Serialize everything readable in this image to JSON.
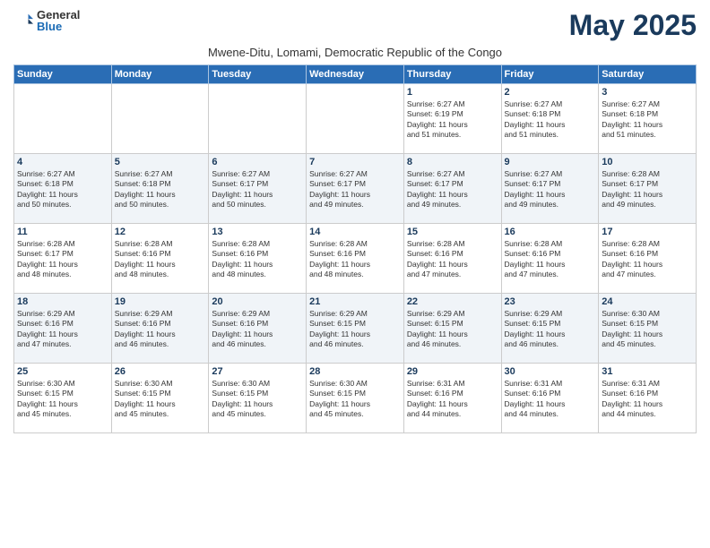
{
  "logo": {
    "general": "General",
    "blue": "Blue"
  },
  "title": "May 2025",
  "subtitle": "Mwene-Ditu, Lomami, Democratic Republic of the Congo",
  "days_header": [
    "Sunday",
    "Monday",
    "Tuesday",
    "Wednesday",
    "Thursday",
    "Friday",
    "Saturday"
  ],
  "weeks": [
    [
      {
        "day": "",
        "info": ""
      },
      {
        "day": "",
        "info": ""
      },
      {
        "day": "",
        "info": ""
      },
      {
        "day": "",
        "info": ""
      },
      {
        "day": "1",
        "info": "Sunrise: 6:27 AM\nSunset: 6:19 PM\nDaylight: 11 hours\nand 51 minutes."
      },
      {
        "day": "2",
        "info": "Sunrise: 6:27 AM\nSunset: 6:18 PM\nDaylight: 11 hours\nand 51 minutes."
      },
      {
        "day": "3",
        "info": "Sunrise: 6:27 AM\nSunset: 6:18 PM\nDaylight: 11 hours\nand 51 minutes."
      }
    ],
    [
      {
        "day": "4",
        "info": "Sunrise: 6:27 AM\nSunset: 6:18 PM\nDaylight: 11 hours\nand 50 minutes."
      },
      {
        "day": "5",
        "info": "Sunrise: 6:27 AM\nSunset: 6:18 PM\nDaylight: 11 hours\nand 50 minutes."
      },
      {
        "day": "6",
        "info": "Sunrise: 6:27 AM\nSunset: 6:17 PM\nDaylight: 11 hours\nand 50 minutes."
      },
      {
        "day": "7",
        "info": "Sunrise: 6:27 AM\nSunset: 6:17 PM\nDaylight: 11 hours\nand 49 minutes."
      },
      {
        "day": "8",
        "info": "Sunrise: 6:27 AM\nSunset: 6:17 PM\nDaylight: 11 hours\nand 49 minutes."
      },
      {
        "day": "9",
        "info": "Sunrise: 6:27 AM\nSunset: 6:17 PM\nDaylight: 11 hours\nand 49 minutes."
      },
      {
        "day": "10",
        "info": "Sunrise: 6:28 AM\nSunset: 6:17 PM\nDaylight: 11 hours\nand 49 minutes."
      }
    ],
    [
      {
        "day": "11",
        "info": "Sunrise: 6:28 AM\nSunset: 6:17 PM\nDaylight: 11 hours\nand 48 minutes."
      },
      {
        "day": "12",
        "info": "Sunrise: 6:28 AM\nSunset: 6:16 PM\nDaylight: 11 hours\nand 48 minutes."
      },
      {
        "day": "13",
        "info": "Sunrise: 6:28 AM\nSunset: 6:16 PM\nDaylight: 11 hours\nand 48 minutes."
      },
      {
        "day": "14",
        "info": "Sunrise: 6:28 AM\nSunset: 6:16 PM\nDaylight: 11 hours\nand 48 minutes."
      },
      {
        "day": "15",
        "info": "Sunrise: 6:28 AM\nSunset: 6:16 PM\nDaylight: 11 hours\nand 47 minutes."
      },
      {
        "day": "16",
        "info": "Sunrise: 6:28 AM\nSunset: 6:16 PM\nDaylight: 11 hours\nand 47 minutes."
      },
      {
        "day": "17",
        "info": "Sunrise: 6:28 AM\nSunset: 6:16 PM\nDaylight: 11 hours\nand 47 minutes."
      }
    ],
    [
      {
        "day": "18",
        "info": "Sunrise: 6:29 AM\nSunset: 6:16 PM\nDaylight: 11 hours\nand 47 minutes."
      },
      {
        "day": "19",
        "info": "Sunrise: 6:29 AM\nSunset: 6:16 PM\nDaylight: 11 hours\nand 46 minutes."
      },
      {
        "day": "20",
        "info": "Sunrise: 6:29 AM\nSunset: 6:16 PM\nDaylight: 11 hours\nand 46 minutes."
      },
      {
        "day": "21",
        "info": "Sunrise: 6:29 AM\nSunset: 6:15 PM\nDaylight: 11 hours\nand 46 minutes."
      },
      {
        "day": "22",
        "info": "Sunrise: 6:29 AM\nSunset: 6:15 PM\nDaylight: 11 hours\nand 46 minutes."
      },
      {
        "day": "23",
        "info": "Sunrise: 6:29 AM\nSunset: 6:15 PM\nDaylight: 11 hours\nand 46 minutes."
      },
      {
        "day": "24",
        "info": "Sunrise: 6:30 AM\nSunset: 6:15 PM\nDaylight: 11 hours\nand 45 minutes."
      }
    ],
    [
      {
        "day": "25",
        "info": "Sunrise: 6:30 AM\nSunset: 6:15 PM\nDaylight: 11 hours\nand 45 minutes."
      },
      {
        "day": "26",
        "info": "Sunrise: 6:30 AM\nSunset: 6:15 PM\nDaylight: 11 hours\nand 45 minutes."
      },
      {
        "day": "27",
        "info": "Sunrise: 6:30 AM\nSunset: 6:15 PM\nDaylight: 11 hours\nand 45 minutes."
      },
      {
        "day": "28",
        "info": "Sunrise: 6:30 AM\nSunset: 6:15 PM\nDaylight: 11 hours\nand 45 minutes."
      },
      {
        "day": "29",
        "info": "Sunrise: 6:31 AM\nSunset: 6:16 PM\nDaylight: 11 hours\nand 44 minutes."
      },
      {
        "day": "30",
        "info": "Sunrise: 6:31 AM\nSunset: 6:16 PM\nDaylight: 11 hours\nand 44 minutes."
      },
      {
        "day": "31",
        "info": "Sunrise: 6:31 AM\nSunset: 6:16 PM\nDaylight: 11 hours\nand 44 minutes."
      }
    ]
  ]
}
